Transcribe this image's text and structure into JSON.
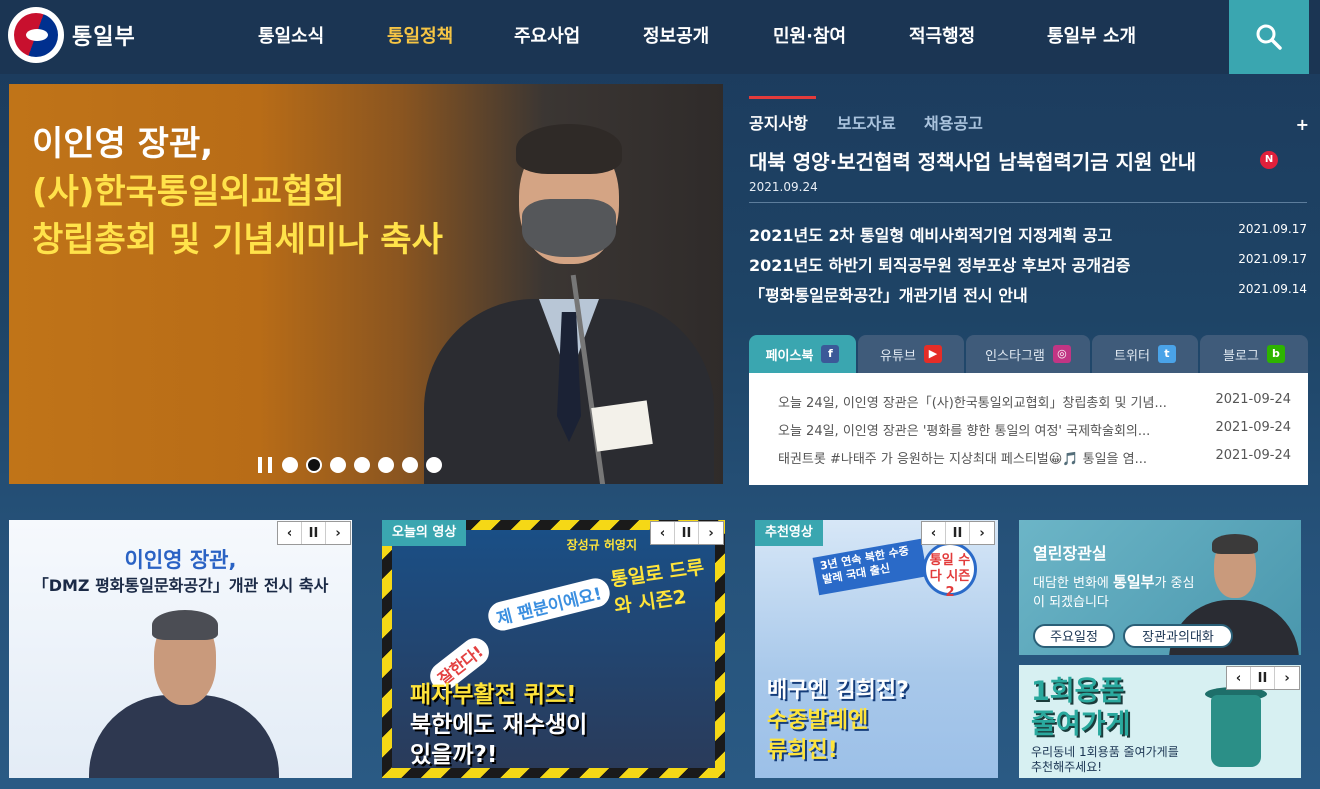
{
  "header": {
    "logo_text": "통일부",
    "menu": [
      "통일소식",
      "통일정책",
      "주요사업",
      "정보공개",
      "민원·참여",
      "적극행정",
      "통일부 소개"
    ],
    "active_menu": "통일정책",
    "search_icon": "search-icon"
  },
  "banner": {
    "line1": "이인영 장관,",
    "line2": "(사)한국통일외교협회",
    "line3": "창립총회 및 기념세미나 축사",
    "pause_icon": "pause-icon",
    "slides_count": 7,
    "active_slide": 2
  },
  "notice": {
    "tabs": [
      "공지사항",
      "보도자료",
      "채용공고"
    ],
    "active_tab": "공지사항",
    "more": "+",
    "headline": "대북 영양·보건협력 정책사업 남북협력기금 지원 안내",
    "headline_badge": "N",
    "headline_date": "2021.09.24",
    "items": [
      {
        "title": "2021년도 2차 통일형 예비사회적기업 지정계획 공고",
        "date": "2021.09.17"
      },
      {
        "title": "2021년도 하반기 퇴직공무원 정부포상 후보자 공개검증",
        "date": "2021.09.17"
      },
      {
        "title": "「평화통일문화공간」개관기념 전시 안내",
        "date": "2021.09.14"
      }
    ]
  },
  "sns": {
    "tabs": [
      {
        "label": "페이스북",
        "icon": "f",
        "color": "#3b5998"
      },
      {
        "label": "유튜브",
        "icon": "▶",
        "color": "#e52d27"
      },
      {
        "label": "인스타그램",
        "icon": "◎",
        "color": "#c13584"
      },
      {
        "label": "트위터",
        "icon": "t",
        "color": "#4aa3e8"
      },
      {
        "label": "블로그",
        "icon": "b",
        "color": "#2db400"
      }
    ],
    "active_tab": "페이스북",
    "posts": [
      {
        "text": "오늘 24일, 이인영 장관은「(사)한국통일외교협회」창립총회 및 기념...",
        "date": "2021-09-24"
      },
      {
        "text": "오늘 24일, 이인영 장관은 '평화를 향한 통일의 여정' 국제학술회의...",
        "date": "2021-09-24"
      },
      {
        "text": "태권트롯 #나태주 가 응원하는 지상최대 페스티벌😀🎵 통일을 염...",
        "date": "2021-09-24"
      }
    ]
  },
  "cards": {
    "controls": [
      "‹",
      "II",
      "›"
    ],
    "card1": {
      "line1": "이인영 장관,",
      "line2": "「DMZ 평화통일문화공간」개관 전시 축사"
    },
    "card2": {
      "label": "오늘의 영상",
      "show": "장성규 허영지",
      "bubble1": "제 팬분이에요!",
      "bubble2": "잘한다!",
      "logo": "통일로 드루와 시즌2",
      "big1": "패자부활전 퀴즈!",
      "big2": "북한에도 재수생이",
      "big3": "있을까?!"
    },
    "card3": {
      "label": "추천영상",
      "tag": "3년 연속 북한 수중발레 국대 출신",
      "circle": "통일 수다 시즌2",
      "big1": "배구엔 김희진?",
      "big2": "수중발레엔",
      "big3": "류희진!"
    },
    "card4": {
      "title": "열린장관실",
      "desc1": "대담한 변화에",
      "desc_bold": "통일부",
      "desc2": "가 중심이 되겠습니다",
      "btn1": "주요일정",
      "btn2": "장관과의대화"
    },
    "card5": {
      "big1": "1회용품",
      "big2": "줄여가게",
      "small1": "우리동네 1회용품 줄여가게를",
      "small2": "추천해주세요!"
    }
  }
}
